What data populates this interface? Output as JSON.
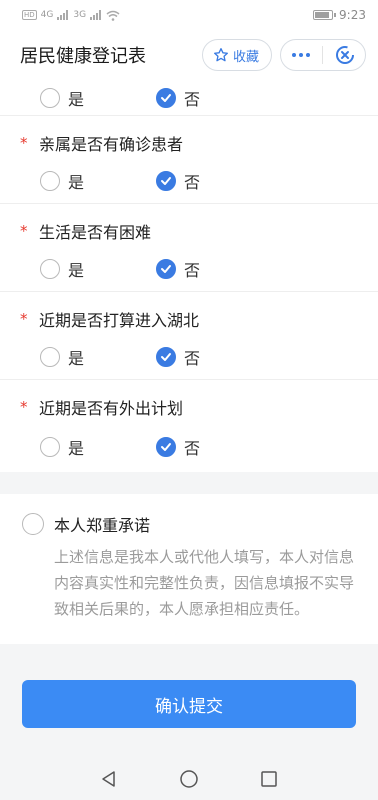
{
  "status_bar": {
    "left_indicators": [
      "HD",
      "4G",
      "3G"
    ],
    "time": "9:23"
  },
  "header": {
    "title": "居民健康登记表",
    "favorite_label": "收藏"
  },
  "options": {
    "yes": "是",
    "no": "否"
  },
  "questions": [
    {
      "label": "",
      "required": false,
      "selected": "no"
    },
    {
      "label": "亲属是否有确诊患者",
      "required": true,
      "selected": "no"
    },
    {
      "label": "生活是否有困难",
      "required": true,
      "selected": "no"
    },
    {
      "label": "近期是否打算进入湖北",
      "required": true,
      "selected": "no"
    },
    {
      "label": "近期是否有外出计划",
      "required": true,
      "selected": "no"
    }
  ],
  "required_mark": "*",
  "promise": {
    "title": "本人郑重承诺",
    "description": "上述信息是我本人或代他人填写，本人对信息内容真实性和完整性负责，因信息填报不实导致相关后果的，本人愿承担相应责任。"
  },
  "submit_label": "确认提交",
  "colors": {
    "accent": "#3a7be2",
    "button": "#3b8bf4",
    "required": "#e63a2f"
  }
}
